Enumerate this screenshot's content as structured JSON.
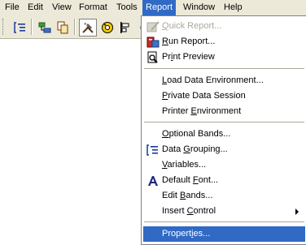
{
  "menubar": {
    "items": [
      {
        "label": "File"
      },
      {
        "label": "Edit"
      },
      {
        "label": "View"
      },
      {
        "label": "Format"
      },
      {
        "label": "Tools"
      },
      {
        "label": "Report",
        "active": true
      },
      {
        "label": "Window"
      },
      {
        "label": "Help"
      }
    ]
  },
  "toolbar": {
    "buttons": [
      {
        "icon": "data-grouping-icon"
      },
      {
        "icon": "data-environment-icon"
      },
      {
        "icon": "copy-icon"
      },
      {
        "icon": "layout-tools-icon",
        "pressed": true
      },
      {
        "icon": "color-palette-icon"
      },
      {
        "icon": "align-icon"
      },
      {
        "icon": "more-tools-icon"
      }
    ]
  },
  "report_menu": {
    "quick_report": {
      "pre": "",
      "key": "Q",
      "post": "uick Report..."
    },
    "run_report": {
      "pre": "",
      "key": "R",
      "post": "un Report..."
    },
    "print_preview": {
      "pre": "Pr",
      "key": "i",
      "post": "nt Preview"
    },
    "load_data_env": {
      "pre": "",
      "key": "L",
      "post": "oad Data Environment..."
    },
    "private_data_session": {
      "pre": "",
      "key": "P",
      "post": "rivate Data Session"
    },
    "printer_environment": {
      "pre": "Printer ",
      "key": "E",
      "post": "nvironment"
    },
    "optional_bands": {
      "pre": "",
      "key": "O",
      "post": "ptional Bands..."
    },
    "data_grouping": {
      "pre": "Data ",
      "key": "G",
      "post": "rouping..."
    },
    "variables": {
      "pre": "",
      "key": "V",
      "post": "ariables..."
    },
    "default_font": {
      "pre": "Default ",
      "key": "F",
      "post": "ont..."
    },
    "edit_bands": {
      "pre": "Edit ",
      "key": "B",
      "post": "ands..."
    },
    "insert_control": {
      "pre": "Insert ",
      "key": "C",
      "post": "ontrol"
    },
    "properties": {
      "pre": "Propert",
      "key": "i",
      "post": "es..."
    }
  },
  "colors": {
    "highlight": "#316ac5",
    "menubar_bg": "#ece9d8",
    "disabled_text": "#aca899"
  }
}
